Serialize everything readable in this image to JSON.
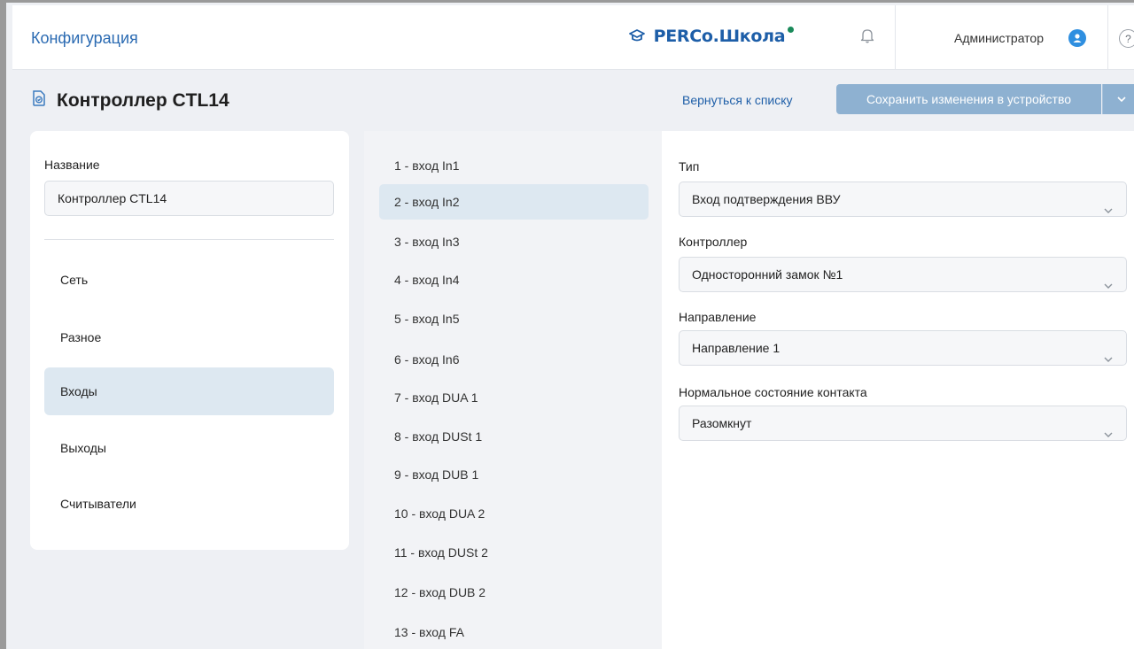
{
  "header": {
    "app_title": "Конфигурация",
    "logo_text": "PERCo.Школа",
    "user_name": "Администратор",
    "help_glyph": "?"
  },
  "page": {
    "title": "Контроллер CTL14",
    "back_link": "Вернуться к списку",
    "save_label": "Сохранить изменения в устройство"
  },
  "left": {
    "name_label": "Название",
    "name_value": "Контроллер CTL14",
    "nav": [
      {
        "label": "Сеть",
        "active": false
      },
      {
        "label": "Разное",
        "active": false
      },
      {
        "label": "Входы",
        "active": true
      },
      {
        "label": "Выходы",
        "active": false
      },
      {
        "label": "Считыватели",
        "active": false
      }
    ]
  },
  "inputs": [
    {
      "label": "1 - вход In1",
      "active": false
    },
    {
      "label": "2 - вход In2",
      "active": true
    },
    {
      "label": "3 - вход In3",
      "active": false
    },
    {
      "label": "4 - вход In4",
      "active": false
    },
    {
      "label": "5 - вход In5",
      "active": false
    },
    {
      "label": "6 - вход In6",
      "active": false
    },
    {
      "label": "7 - вход DUA 1",
      "active": false
    },
    {
      "label": "8 - вход DUSt 1",
      "active": false
    },
    {
      "label": "9 - вход DUB 1",
      "active": false
    },
    {
      "label": "10 - вход DUA 2",
      "active": false
    },
    {
      "label": "11 - вход DUSt 2",
      "active": false
    },
    {
      "label": "12 - вход DUB 2",
      "active": false
    },
    {
      "label": "13 - вход FA",
      "active": false
    }
  ],
  "fields": [
    {
      "label": "Тип",
      "value": "Вход подтверждения ВВУ"
    },
    {
      "label": "Контроллер",
      "value": "Односторонний замок №1"
    },
    {
      "label": "Направление",
      "value": "Направление 1"
    },
    {
      "label": "Нормальное состояние контакта",
      "value": "Разомкнут"
    }
  ],
  "colors": {
    "accent": "#2a6ab2",
    "save_button": "#8eb1d1",
    "active_item": "#dde8f1",
    "logo_dot": "#1a8a5a"
  },
  "icons": {
    "logo": "graduation-cap-icon",
    "notifications": "bell-icon",
    "user": "user-avatar-icon",
    "help": "help-icon",
    "device": "controller-device-icon",
    "dropdown": "chevron-down-icon"
  }
}
